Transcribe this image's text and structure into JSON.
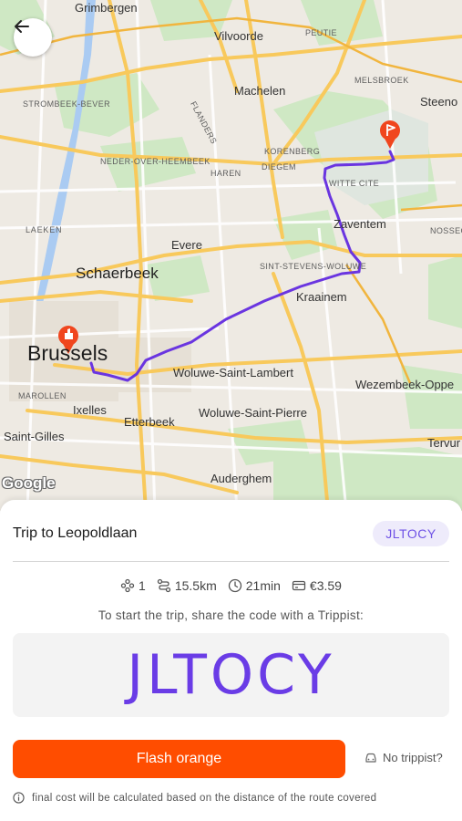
{
  "map": {
    "places": [
      {
        "name": "Grimbergen"
      },
      {
        "name": "Vilvoorde"
      },
      {
        "name": "PEUTIE"
      },
      {
        "name": "Machelen"
      },
      {
        "name": "MELSBROEK"
      },
      {
        "name": "Steeno"
      },
      {
        "name": "STROMBEEK-BEVER"
      },
      {
        "name": "FLANDERS"
      },
      {
        "name": "KORENBERG"
      },
      {
        "name": "NEDER-OVER-HEEMBEEK"
      },
      {
        "name": "HAREN"
      },
      {
        "name": "DIEGEM"
      },
      {
        "name": "WITTE CITE"
      },
      {
        "name": "Zaventem"
      },
      {
        "name": "NOSSEG"
      },
      {
        "name": "LAEKEN"
      },
      {
        "name": "Evere"
      },
      {
        "name": "SINT-STEVENS-WOLUWE"
      },
      {
        "name": "Schaerbeek"
      },
      {
        "name": "Kraainem"
      },
      {
        "name": "Brussels"
      },
      {
        "name": "Woluwe-Saint-Lambert"
      },
      {
        "name": "Wezembeek-Oppe"
      },
      {
        "name": "MAROLLEN"
      },
      {
        "name": "Ixelles"
      },
      {
        "name": "Etterbeek"
      },
      {
        "name": "Woluwe-Saint-Pierre"
      },
      {
        "name": "Saint-Gilles"
      },
      {
        "name": "Tervur"
      },
      {
        "name": "Auderghem"
      }
    ],
    "attribution": "Google",
    "route_color": "#6a35e0",
    "marker_color": "#f0461e"
  },
  "sheet": {
    "title": "Trip to Leopoldlaan",
    "badge_code": "JLTOCY",
    "stats": {
      "passengers": "1",
      "distance": "15.5km",
      "duration": "21min",
      "cost": "€3.59"
    },
    "instruction": "To start the trip, share the code with a Trippist:",
    "code": "JLTOCY",
    "flash_button": "Flash orange",
    "no_trippist": "No trippist?",
    "note": "final cost will be calculated based on the distance of the route covered"
  }
}
